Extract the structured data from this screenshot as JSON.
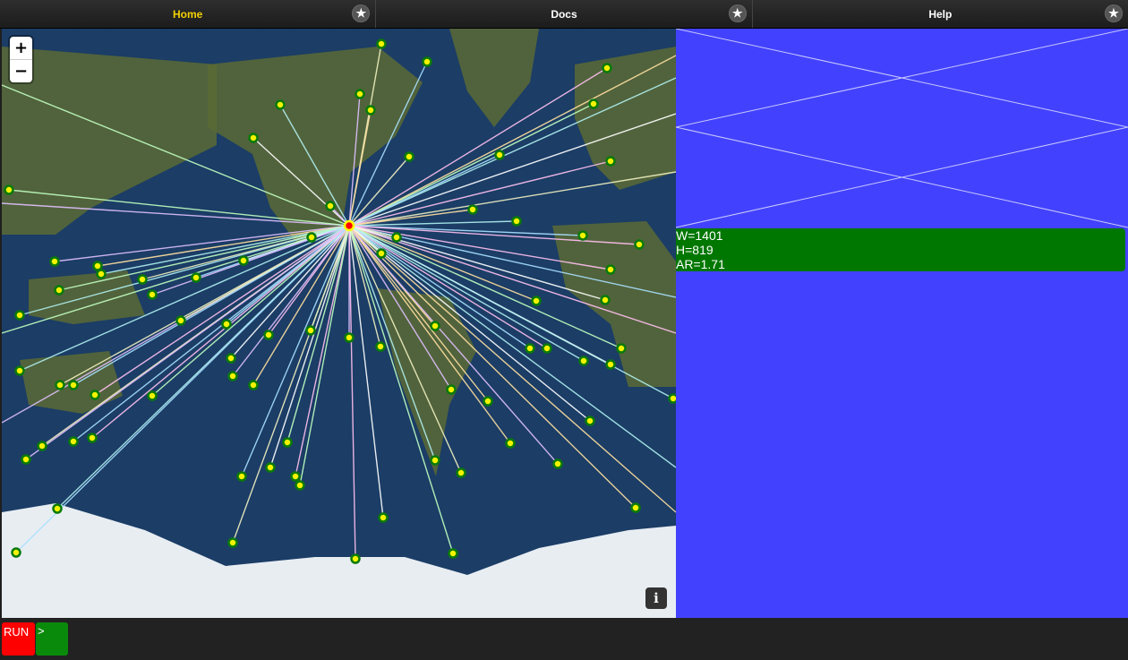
{
  "tabs": [
    {
      "label": "Home",
      "active": true
    },
    {
      "label": "Docs",
      "active": false
    },
    {
      "label": "Help",
      "active": false
    }
  ],
  "star_glyph": "★",
  "map": {
    "zoom_in": "+",
    "zoom_out": "−",
    "info": "i",
    "colors": {
      "ocean": "#1b3d66",
      "land": "#5a6a35",
      "ice": "#e8edf2",
      "marker_fill": "#f3f300",
      "marker_ring": "#0a7a0a",
      "origin_fill": "#ff0000",
      "origin_ring": "#ffff00"
    },
    "icons": {
      "zoom_in": "plus-icon",
      "zoom_out": "minus-icon",
      "info": "info-icon"
    }
  },
  "right_pane": {
    "color": "#4242fe",
    "dims": {
      "w": "W=1401",
      "h": "H=819",
      "ar": "AR=1.71"
    }
  },
  "bottom": {
    "run_label": "RUN",
    "go_label": ">"
  }
}
